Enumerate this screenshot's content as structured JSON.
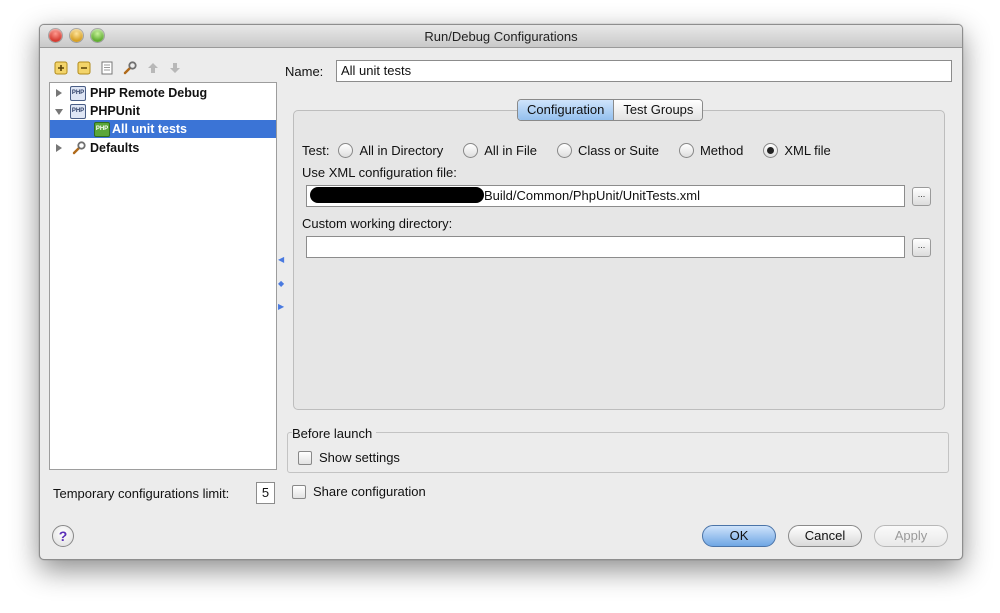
{
  "window": {
    "title": "Run/Debug Configurations"
  },
  "toolbar": {
    "icons": [
      "add-config-icon",
      "remove-config-icon",
      "copy-config-icon",
      "edit-defaults-icon",
      "move-up-icon",
      "move-down-icon"
    ]
  },
  "tree": {
    "items": [
      {
        "label": "PHP Remote Debug",
        "icon": "php-remote-debug-icon",
        "expanded": false,
        "selected": false
      },
      {
        "label": "PHPUnit",
        "icon": "phpunit-icon",
        "expanded": true,
        "selected": false
      },
      {
        "label": "All unit tests",
        "icon": "phpunit-config-icon",
        "expanded": null,
        "selected": true
      },
      {
        "label": "Defaults",
        "icon": "defaults-wrench-icon",
        "expanded": false,
        "selected": false
      }
    ]
  },
  "limit": {
    "label": "Temporary configurations limit:",
    "value": "5"
  },
  "name": {
    "label": "Name:",
    "value": "All unit tests"
  },
  "tabs": [
    {
      "label": "Configuration",
      "active": true
    },
    {
      "label": "Test Groups",
      "active": false
    }
  ],
  "test": {
    "label": "Test:",
    "options": [
      {
        "label": "All in Directory",
        "selected": false
      },
      {
        "label": "All in File",
        "selected": false
      },
      {
        "label": "Class or Suite",
        "selected": false
      },
      {
        "label": "Method",
        "selected": false
      },
      {
        "label": "XML file",
        "selected": true
      }
    ]
  },
  "xml_config": {
    "label": "Use XML configuration file:",
    "value": "Build/Common/PhpUnit/UnitTests.xml",
    "browse_label": "..."
  },
  "working_dir": {
    "label": "Custom working directory:",
    "value": "",
    "browse_label": "..."
  },
  "before_launch": {
    "legend": "Before launch",
    "show_settings_label": "Show settings",
    "show_settings_checked": false
  },
  "share": {
    "label": "Share configuration",
    "checked": false
  },
  "help": {
    "symbol": "?"
  },
  "buttons": {
    "ok": "OK",
    "cancel": "Cancel",
    "apply": "Apply"
  },
  "colors": {
    "selection": "#3b74d6",
    "primary_button": "#6fa6e4",
    "tab_active": "#94c0ee"
  }
}
